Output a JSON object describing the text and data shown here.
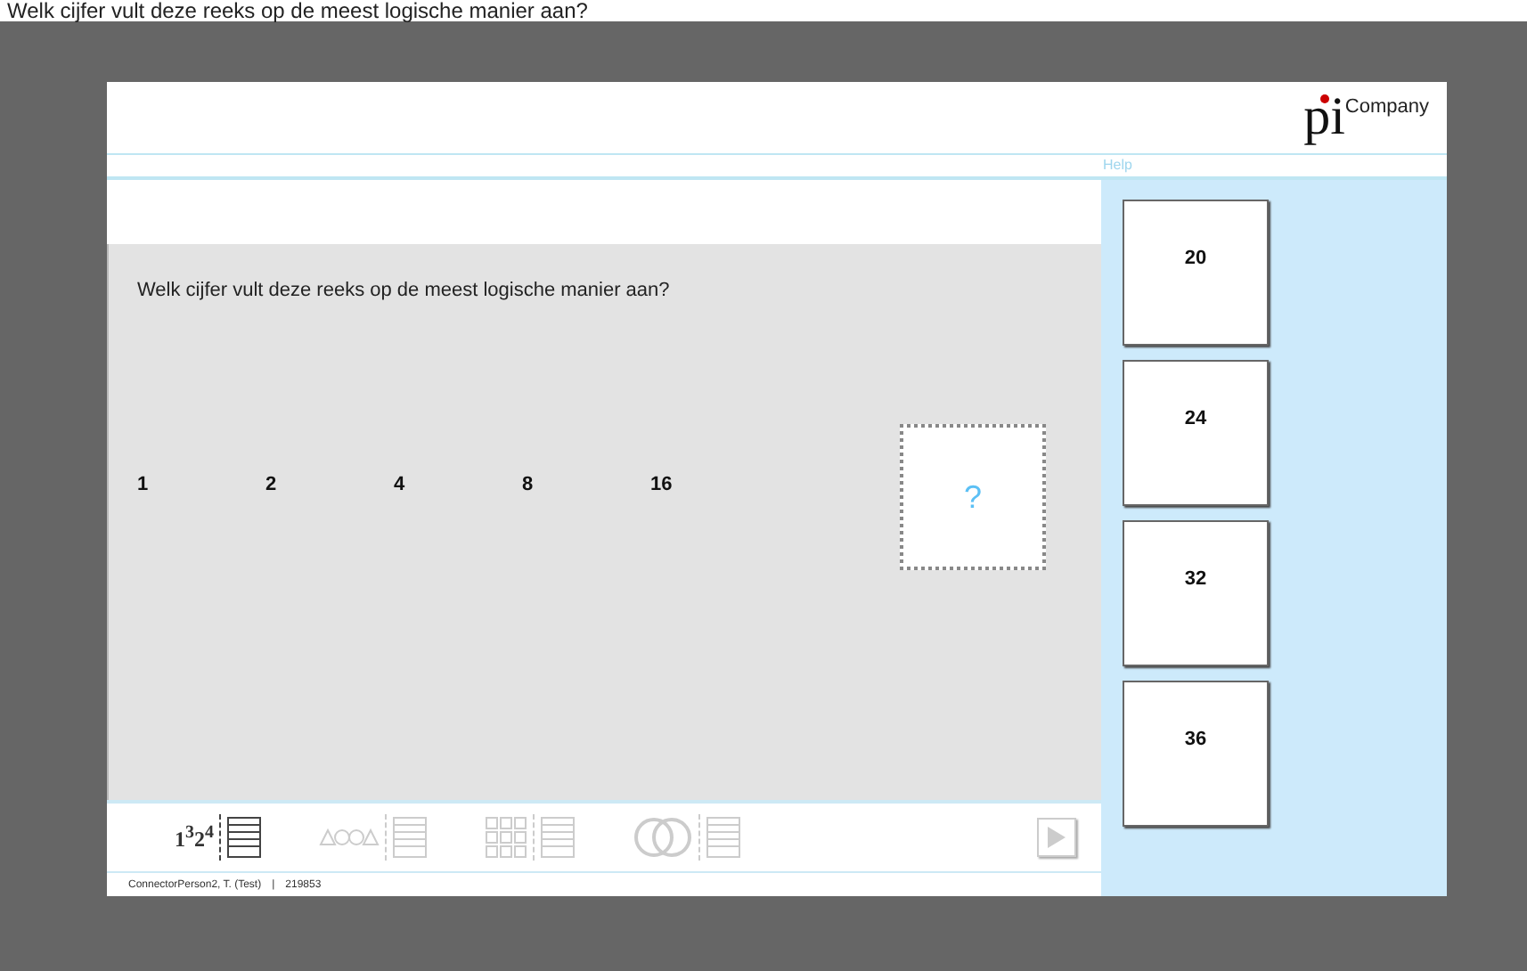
{
  "caption": "Welk cijfer vult deze reeks op de meest logische manier aan?",
  "header": {
    "logo_mark": "pi",
    "logo_text": "Company",
    "help": "Help"
  },
  "question": {
    "text": "Welk cijfer vult deze reeks op de meest logische manier aan?",
    "series": [
      "1",
      "2",
      "4",
      "8",
      "16"
    ],
    "blank": "?"
  },
  "answers": [
    "20",
    "24",
    "32",
    "36"
  ],
  "toolbar": {
    "tabs": [
      {
        "kind": "numbers",
        "label": "1$^{3}$2$^{4}$",
        "selected": true
      },
      {
        "kind": "shapes",
        "selected": false
      },
      {
        "kind": "matrix",
        "selected": false
      },
      {
        "kind": "venn",
        "selected": false
      }
    ]
  },
  "status_bar": {
    "user": "ConnectorPerson2, T. (Test)",
    "separator": "|",
    "code": "219853"
  }
}
